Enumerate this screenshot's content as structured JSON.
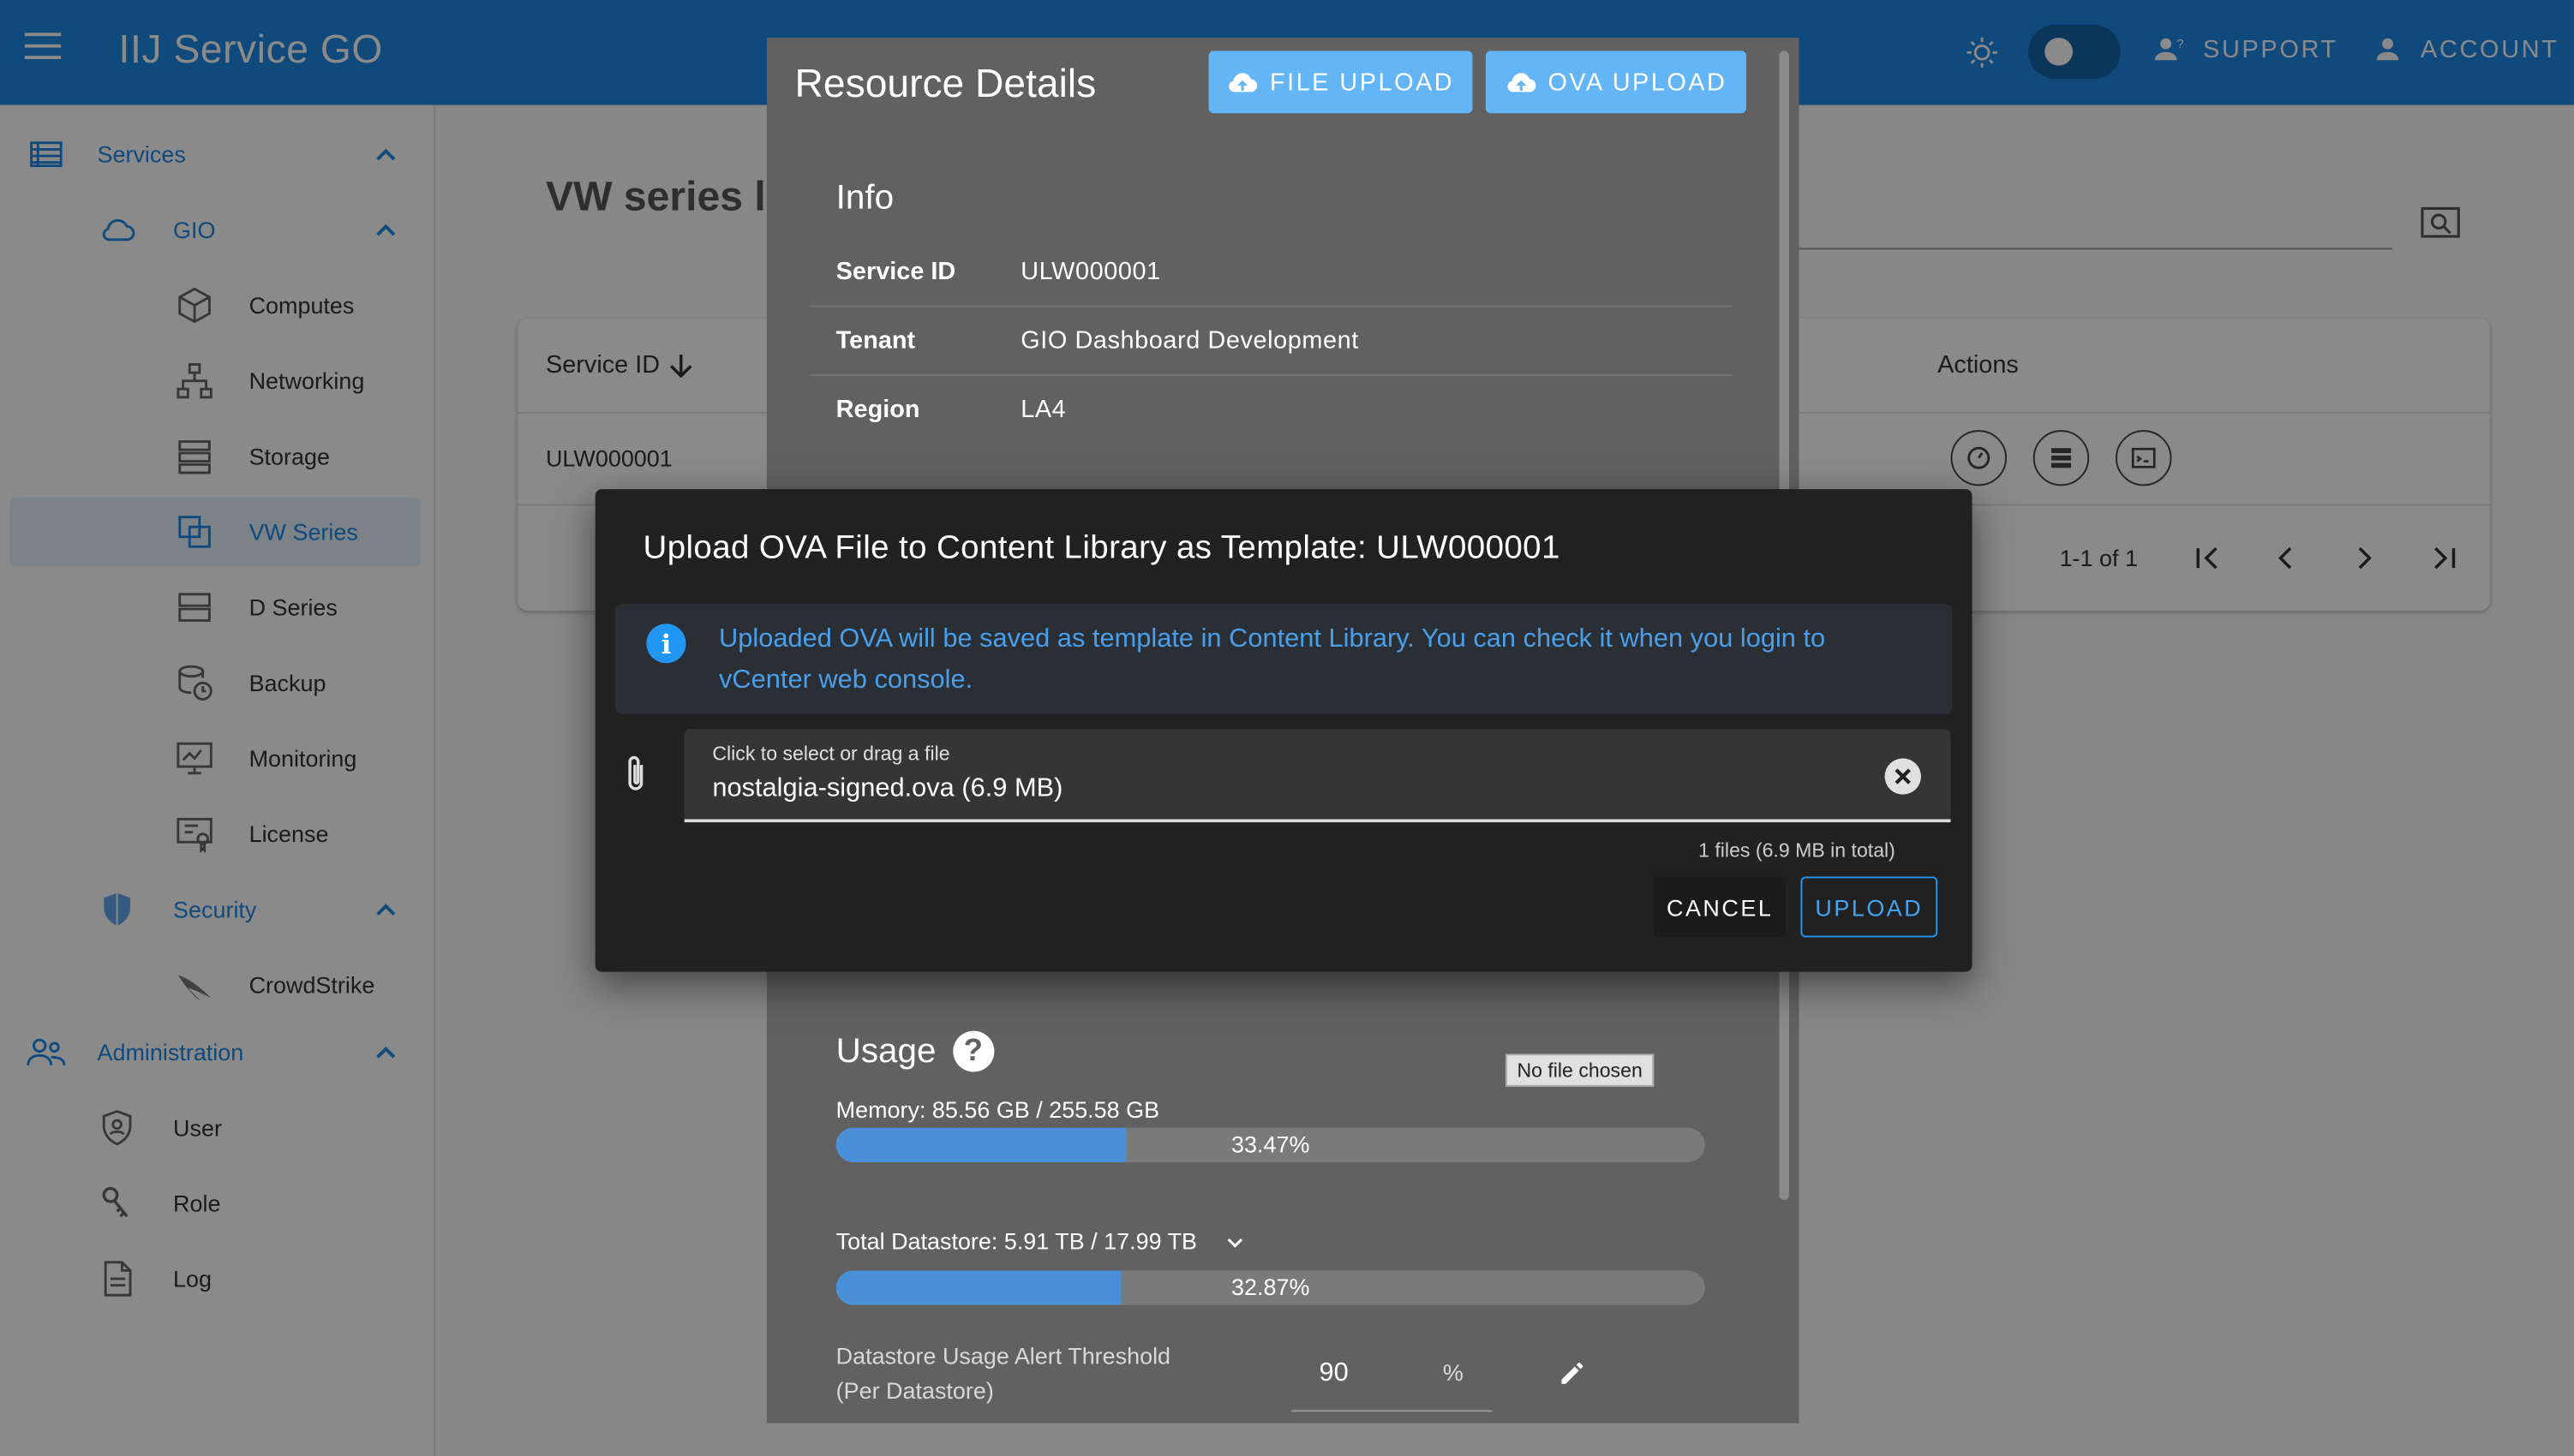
{
  "header": {
    "brand": "IIJ Service GO",
    "support_label": "SUPPORT",
    "account_label": "ACCOUNT"
  },
  "sidebar": {
    "services": "Services",
    "gio": "GIO",
    "computes": "Computes",
    "networking": "Networking",
    "storage": "Storage",
    "vw_series": "VW Series",
    "d_series": "D Series",
    "backup": "Backup",
    "monitoring": "Monitoring",
    "license": "License",
    "security": "Security",
    "crowdstrike": "CrowdStrike",
    "administration": "Administration",
    "user": "User",
    "role": "Role",
    "log": "Log"
  },
  "main": {
    "page_title": "VW series li",
    "table": {
      "col_service_id": "Service ID",
      "col_actions": "Actions",
      "row_service_id": "ULW000001",
      "pagination": "1-1 of 1"
    }
  },
  "details": {
    "title": "Resource Details",
    "file_upload_label": "FILE UPLOAD",
    "ova_upload_label": "OVA UPLOAD",
    "info_title": "Info",
    "info": [
      {
        "key": "Service ID",
        "value": "ULW000001"
      },
      {
        "key": "Tenant",
        "value": "GIO Dashboard Development"
      },
      {
        "key": "Region",
        "value": "LA4"
      }
    ],
    "usage_title": "Usage",
    "no_file_chosen": "No file chosen",
    "memory_label": "Memory: 85.56 GB / 255.58 GB",
    "memory_pct": "33.47%",
    "memory_fraction": 0.3347,
    "datastore_label": "Total Datastore: 5.91 TB / 17.99 TB",
    "datastore_pct": "32.87%",
    "datastore_fraction": 0.3287,
    "threshold_label_1": "Datastore Usage Alert Threshold",
    "threshold_label_2": "(Per Datastore)",
    "threshold_value": "90",
    "threshold_unit": "%"
  },
  "upload": {
    "title": "Upload OVA File to Content Library as Template: ULW000001",
    "alert_text": "Uploaded OVA will be saved as template in Content Library. You can check it when you login to vCenter web console.",
    "file_label": "Click to select or drag a file",
    "file_value": "nostalgia-signed.ova (6.9 MB)",
    "file_count": "1 files (6.9 MB in total)",
    "cancel_label": "CANCEL",
    "upload_label": "UPLOAD"
  },
  "colors": {
    "primary": "#1e88e5",
    "button_light": "#64b5f6",
    "alert_text": "#4a9fea"
  }
}
